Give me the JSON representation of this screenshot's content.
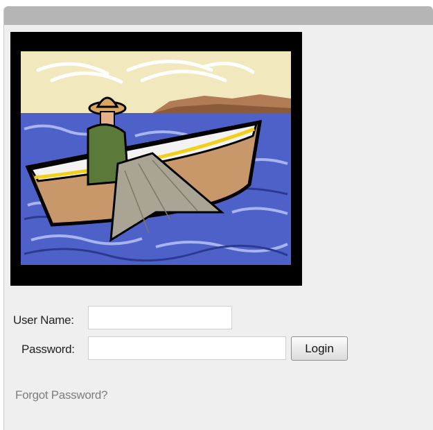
{
  "login_form": {
    "username_label": "User Name:",
    "username_value": "",
    "password_label": "Password:",
    "password_value": "",
    "login_button": "Login",
    "forgot_password_link": "Forgot Password?"
  },
  "logo": {
    "icon": "fisherman-boat-illustration"
  },
  "colors": {
    "header": "#b5b5b5",
    "panel_background": "#efefef",
    "link_text": "#7d7d7d"
  }
}
